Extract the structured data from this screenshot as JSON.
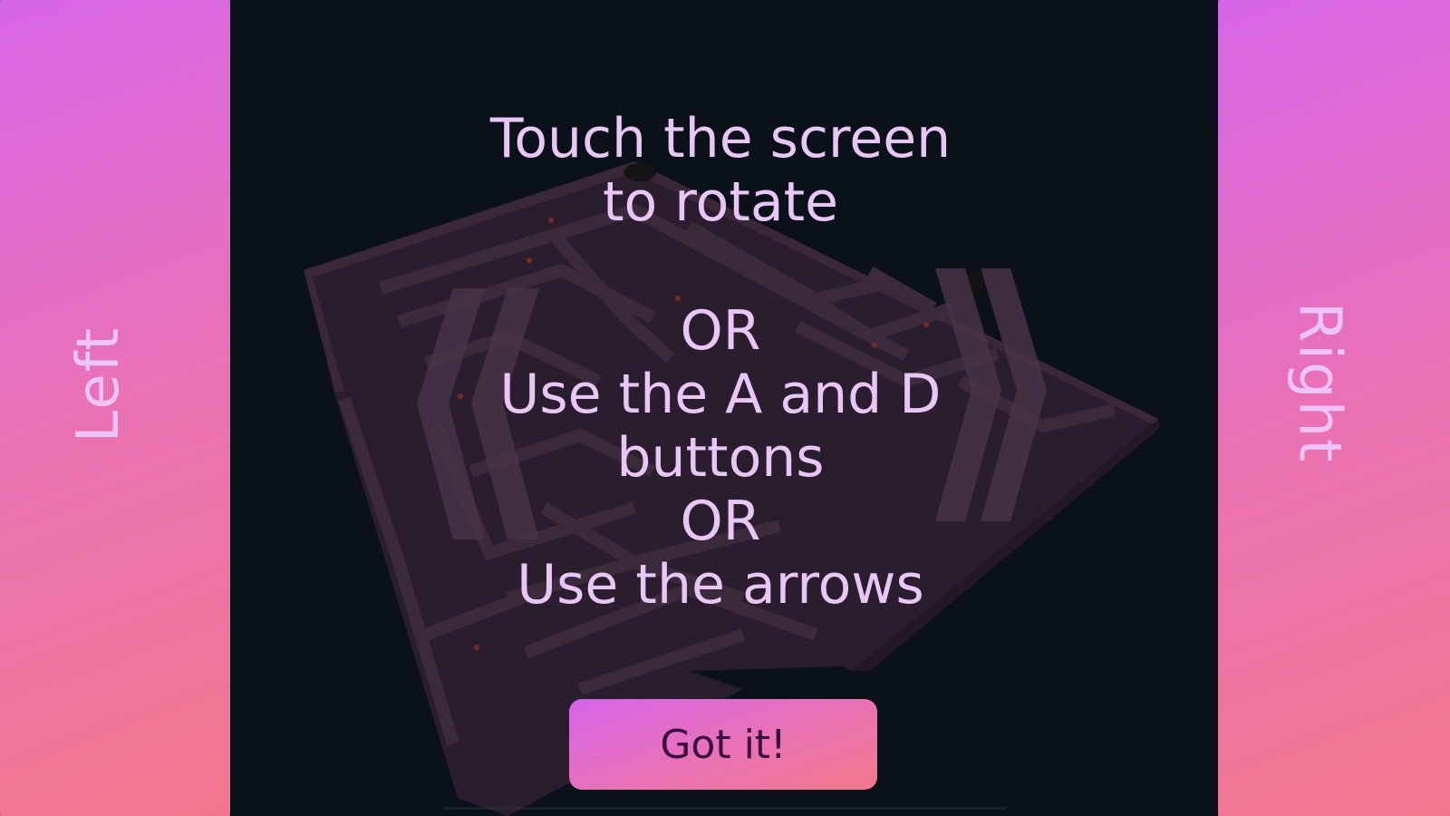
{
  "game": {
    "left_label": "Left",
    "right_label": "Right",
    "instructions": {
      "line1": "Touch the screen",
      "line2": "to rotate",
      "or1": "OR",
      "line3": "Use the A and D",
      "line4": "buttons",
      "or2": "OR",
      "line5": "Use the arrows"
    },
    "confirm_label": "Got it!"
  },
  "colors": {
    "background": "#0b1119",
    "panel_gradient_start": "#d565ea",
    "panel_gradient_end": "#f2778a",
    "text": "#e8c6f6",
    "button_text": "#3a0b3e"
  },
  "icons": {
    "rotate_left": "double-chevron-left-icon",
    "rotate_right": "double-chevron-right-icon"
  }
}
